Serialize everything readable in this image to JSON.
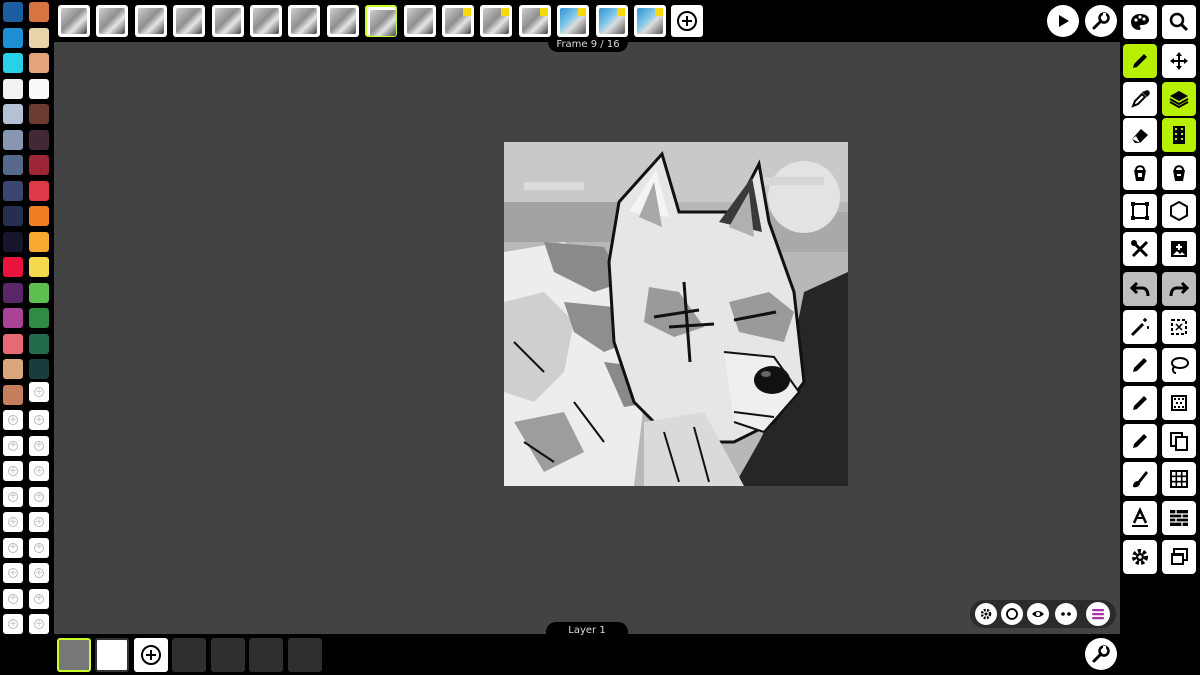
{
  "colors": {
    "accent": "#b7f000",
    "canvas_bg": "#434343",
    "ui_bg": "#000000"
  },
  "palette": {
    "swatches": [
      [
        "#1b5fa0",
        "#d8743f"
      ],
      [
        "#1f8fd3",
        "#e8d4ab"
      ],
      [
        "#29d1e8",
        "#e2a478"
      ],
      [
        "#f2f2f2",
        "#fafafa"
      ],
      [
        "#b4c1d5",
        "#6b3b2f"
      ],
      [
        "#8797b1",
        "#422935"
      ],
      [
        "#56688c",
        "#9e2536"
      ],
      [
        "#3a4670",
        "#dc3a46"
      ],
      [
        "#262f50",
        "#f07f24"
      ],
      [
        "#16152c",
        "#f6a92c"
      ],
      [
        "#e8143c",
        "#f4d94d"
      ],
      [
        "#5a2868",
        "#5cc04e"
      ],
      [
        "#a84398",
        "#2f8c42"
      ],
      [
        "#e86a73",
        "#236b4a"
      ],
      [
        "#d9a779",
        "#193c3c"
      ],
      [
        "#c47e5b",
        ""
      ]
    ],
    "empty_slot_rows": 10,
    "add_icon": "plus-circle-icon"
  },
  "timeline": {
    "frame_count": 16,
    "selected_frame": 9,
    "frames_with_marker": [
      11,
      12,
      13,
      14,
      15,
      16
    ],
    "frames_with_color_thumb": [
      14,
      15,
      16
    ],
    "frame_label": "Frame 9 / 16",
    "add_icon": "plus-circle-icon"
  },
  "header_actions": {
    "play_icon": "play-icon",
    "settings_icon": "wrench-icon"
  },
  "layers": {
    "label": "Layer 1",
    "empty_slots": 4,
    "add_icon": "plus-circle-icon",
    "settings_icon": "wrench-icon"
  },
  "view_controls": [
    "gear-icon",
    "circle-icon",
    "eye-icon",
    "dots-icon",
    "menu-icon"
  ],
  "tools": [
    [
      "palette-icon",
      "zoom-icon"
    ],
    [
      "pencil-icon",
      "move-icon"
    ],
    [
      "eyedropper-icon",
      "layers-icon"
    ],
    [
      "eraser-icon",
      "film-icon"
    ],
    [
      "bucket-icon",
      "bucket-all-icon"
    ],
    [
      "crop-icon",
      "shape-icon"
    ],
    [
      "tools-icon",
      "add-image-icon"
    ],
    [
      "undo-icon",
      "redo-icon"
    ],
    [
      "magic-wand-icon",
      "select-rect-icon"
    ],
    [
      "pen-icon",
      "lasso-icon"
    ],
    [
      "pencil-alt-icon",
      "dither-icon"
    ],
    [
      "marker-icon",
      "copy-icon"
    ],
    [
      "brush-icon",
      "grid-icon"
    ],
    [
      "text-icon",
      "brick-icon"
    ],
    [
      "gear-icon",
      "windows-icon"
    ]
  ],
  "active_tools": [
    "pencil-icon",
    "layers-icon",
    "film-icon"
  ],
  "gray_tools": [
    "undo-icon",
    "redo-icon"
  ]
}
